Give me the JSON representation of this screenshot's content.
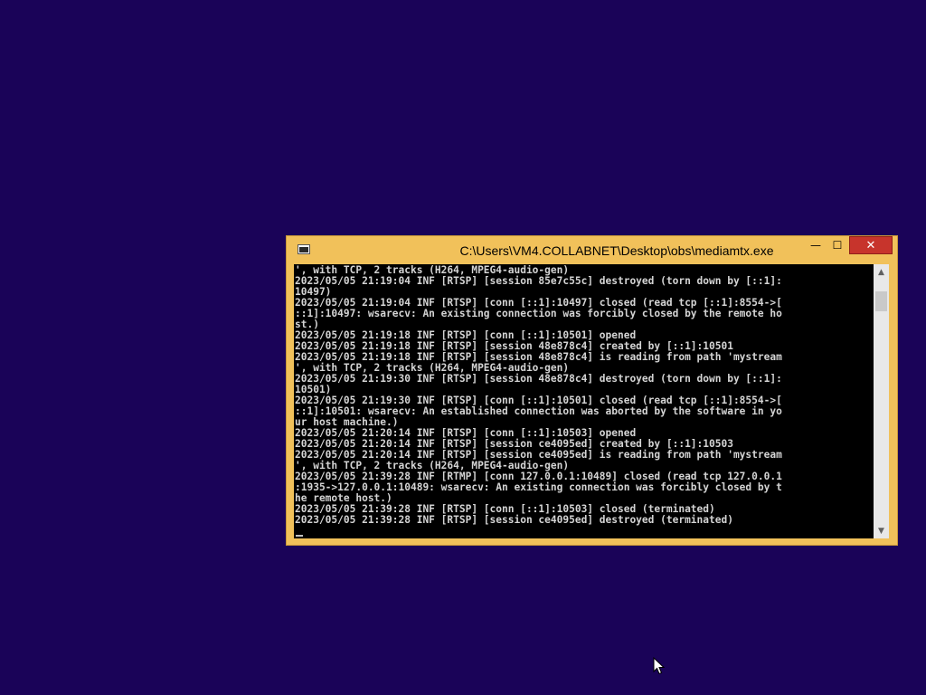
{
  "window": {
    "title": "C:\\Users\\VM4.COLLABNET\\Desktop\\obs\\mediamtx.exe",
    "buttons": {
      "minimize": "—",
      "maximize": "☐",
      "close": "✕"
    }
  },
  "console": {
    "lines": [
      "', with TCP, 2 tracks (H264, MPEG4-audio-gen)",
      "2023/05/05 21:19:04 INF [RTSP] [session 85e7c55c] destroyed (torn down by [::1]:",
      "10497)",
      "2023/05/05 21:19:04 INF [RTSP] [conn [::1]:10497] closed (read tcp [::1]:8554->[",
      "::1]:10497: wsarecv: An existing connection was forcibly closed by the remote ho",
      "st.)",
      "2023/05/05 21:19:18 INF [RTSP] [conn [::1]:10501] opened",
      "2023/05/05 21:19:18 INF [RTSP] [session 48e878c4] created by [::1]:10501",
      "2023/05/05 21:19:18 INF [RTSP] [session 48e878c4] is reading from path 'mystream",
      "', with TCP, 2 tracks (H264, MPEG4-audio-gen)",
      "2023/05/05 21:19:30 INF [RTSP] [session 48e878c4] destroyed (torn down by [::1]:",
      "10501)",
      "2023/05/05 21:19:30 INF [RTSP] [conn [::1]:10501] closed (read tcp [::1]:8554->[",
      "::1]:10501: wsarecv: An established connection was aborted by the software in yo",
      "ur host machine.)",
      "2023/05/05 21:20:14 INF [RTSP] [conn [::1]:10503] opened",
      "2023/05/05 21:20:14 INF [RTSP] [session ce4095ed] created by [::1]:10503",
      "2023/05/05 21:20:14 INF [RTSP] [session ce4095ed] is reading from path 'mystream",
      "', with TCP, 2 tracks (H264, MPEG4-audio-gen)",
      "2023/05/05 21:39:28 INF [RTMP] [conn 127.0.0.1:10489] closed (read tcp 127.0.0.1",
      ":1935->127.0.0.1:10489: wsarecv: An existing connection was forcibly closed by t",
      "he remote host.)",
      "2023/05/05 21:39:28 INF [RTSP] [conn [::1]:10503] closed (terminated)",
      "2023/05/05 21:39:28 INF [RTSP] [session ce4095ed] destroyed (terminated)"
    ]
  },
  "scrollbar": {
    "up_arrow": "▲",
    "down_arrow": "▼"
  },
  "colors": {
    "desktop_background": "#1a0358",
    "window_frame": "#f1c15a",
    "close_button": "#c7342c",
    "console_background": "#000000",
    "console_text": "#d4d4d4"
  }
}
